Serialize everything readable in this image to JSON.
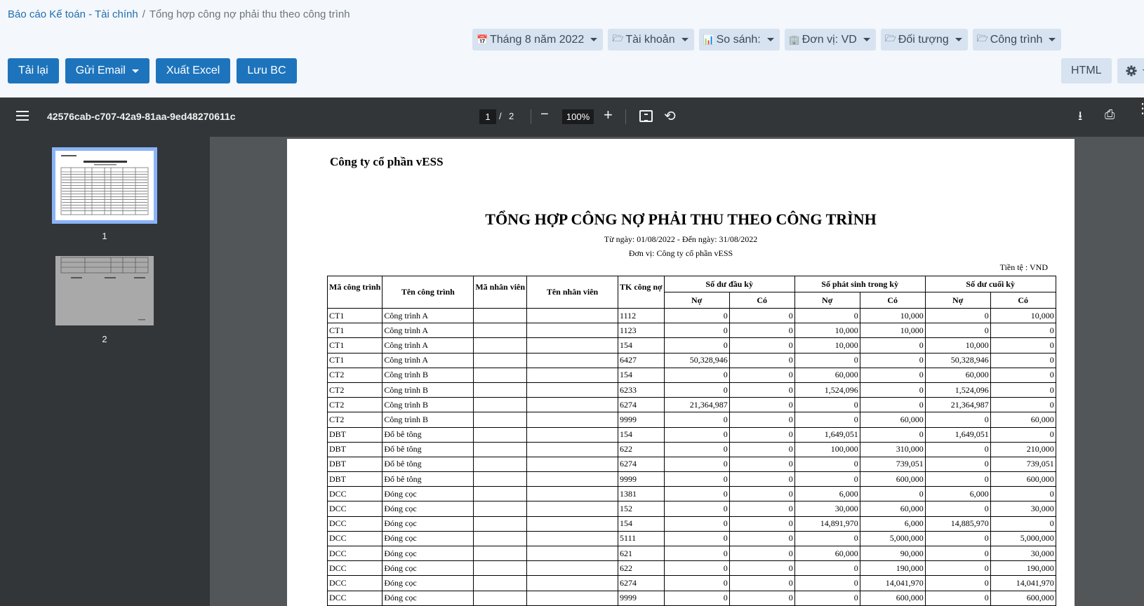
{
  "breadcrumb": {
    "root": "Báo cáo Kế toán - Tài chính",
    "separator": "/",
    "current": "Tổng hợp công nợ phải thu theo công trình"
  },
  "filters": [
    {
      "icon": "calendar-icon",
      "glyph": "📅",
      "label": "Tháng 8 năm 2022"
    },
    {
      "icon": "folder-open-icon",
      "glyph": "🗁",
      "label": "Tài khoản"
    },
    {
      "icon": "bar-chart-icon",
      "glyph": "📊",
      "label": "So sánh:"
    },
    {
      "icon": "building-icon",
      "glyph": "🏢",
      "label": "Đơn vị: VD"
    },
    {
      "icon": "folder-open-icon",
      "glyph": "🗁",
      "label": "Đối tượng"
    },
    {
      "icon": "folder-open-icon",
      "glyph": "🗁",
      "label": "Công trình"
    }
  ],
  "actions": {
    "reload": "Tải lại",
    "send_email": "Gửi Email",
    "export_excel": "Xuất Excel",
    "save_report": "Lưu BC"
  },
  "right_actions": {
    "html": "HTML"
  },
  "viewer": {
    "file_title": "42576cab-c707-42a9-81aa-9ed48270611c",
    "current_page": "1",
    "page_separator": "/",
    "total_pages": "2",
    "zoom": "100%",
    "thumbnails": [
      "1",
      "2"
    ]
  },
  "report": {
    "company": "Công ty cổ phần vESS",
    "title": "TỔNG HỢP CÔNG NỢ PHẢI THU THEO CÔNG TRÌNH",
    "period": "Từ ngày: 01/08/2022 - Đến ngày: 31/08/2022",
    "unit": "Đơn vị: Công ty cổ phần vESS",
    "currency": "Tiền tệ : VND",
    "headers": {
      "ma_cong_trinh": "Mã công trình",
      "ten_cong_trinh": "Tên công trình",
      "ma_nhan_vien": "Mã nhân viên",
      "ten_nhan_vien": "Tên nhân viên",
      "tk_cong_no": "TK công nợ",
      "so_du_dau_ky": "Số dư đầu kỳ",
      "so_phat_sinh": "Số phát sinh trong kỳ",
      "so_du_cuoi_ky": "Số dư cuối kỳ",
      "no": "Nợ",
      "co": "Có"
    },
    "rows": [
      [
        "CT1",
        "Công trình A",
        "",
        "",
        "1112",
        "0",
        "0",
        "0",
        "10,000",
        "0",
        "10,000"
      ],
      [
        "CT1",
        "Công trình A",
        "",
        "",
        "1123",
        "0",
        "0",
        "10,000",
        "10,000",
        "0",
        "0"
      ],
      [
        "CT1",
        "Công trình A",
        "",
        "",
        "154",
        "0",
        "0",
        "10,000",
        "0",
        "10,000",
        "0"
      ],
      [
        "CT1",
        "Công trình A",
        "",
        "",
        "6427",
        "50,328,946",
        "0",
        "0",
        "0",
        "50,328,946",
        "0"
      ],
      [
        "CT2",
        "Công trình B",
        "",
        "",
        "154",
        "0",
        "0",
        "60,000",
        "0",
        "60,000",
        "0"
      ],
      [
        "CT2",
        "Công trình B",
        "",
        "",
        "6233",
        "0",
        "0",
        "1,524,096",
        "0",
        "1,524,096",
        "0"
      ],
      [
        "CT2",
        "Công trình B",
        "",
        "",
        "6274",
        "21,364,987",
        "0",
        "0",
        "0",
        "21,364,987",
        "0"
      ],
      [
        "CT2",
        "Công trình B",
        "",
        "",
        "9999",
        "0",
        "0",
        "0",
        "60,000",
        "0",
        "60,000"
      ],
      [
        "DBT",
        "Đổ bê tông",
        "",
        "",
        "154",
        "0",
        "0",
        "1,649,051",
        "0",
        "1,649,051",
        "0"
      ],
      [
        "DBT",
        "Đổ bê tông",
        "",
        "",
        "622",
        "0",
        "0",
        "100,000",
        "310,000",
        "0",
        "210,000"
      ],
      [
        "DBT",
        "Đổ bê tông",
        "",
        "",
        "6274",
        "0",
        "0",
        "0",
        "739,051",
        "0",
        "739,051"
      ],
      [
        "DBT",
        "Đổ bê tông",
        "",
        "",
        "9999",
        "0",
        "0",
        "0",
        "600,000",
        "0",
        "600,000"
      ],
      [
        "DCC",
        "Đóng cọc",
        "",
        "",
        "1381",
        "0",
        "0",
        "6,000",
        "0",
        "6,000",
        "0"
      ],
      [
        "DCC",
        "Đóng cọc",
        "",
        "",
        "152",
        "0",
        "0",
        "30,000",
        "60,000",
        "0",
        "30,000"
      ],
      [
        "DCC",
        "Đóng cọc",
        "",
        "",
        "154",
        "0",
        "0",
        "14,891,970",
        "6,000",
        "14,885,970",
        "0"
      ],
      [
        "DCC",
        "Đóng cọc",
        "",
        "",
        "5111",
        "0",
        "0",
        "0",
        "5,000,000",
        "0",
        "5,000,000"
      ],
      [
        "DCC",
        "Đóng cọc",
        "",
        "",
        "621",
        "0",
        "0",
        "60,000",
        "90,000",
        "0",
        "30,000"
      ],
      [
        "DCC",
        "Đóng cọc",
        "",
        "",
        "622",
        "0",
        "0",
        "0",
        "190,000",
        "0",
        "190,000"
      ],
      [
        "DCC",
        "Đóng cọc",
        "",
        "",
        "6274",
        "0",
        "0",
        "0",
        "14,041,970",
        "0",
        "14,041,970"
      ],
      [
        "DCC",
        "Đóng cọc",
        "",
        "",
        "9999",
        "0",
        "0",
        "0",
        "600,000",
        "0",
        "600,000"
      ]
    ]
  }
}
